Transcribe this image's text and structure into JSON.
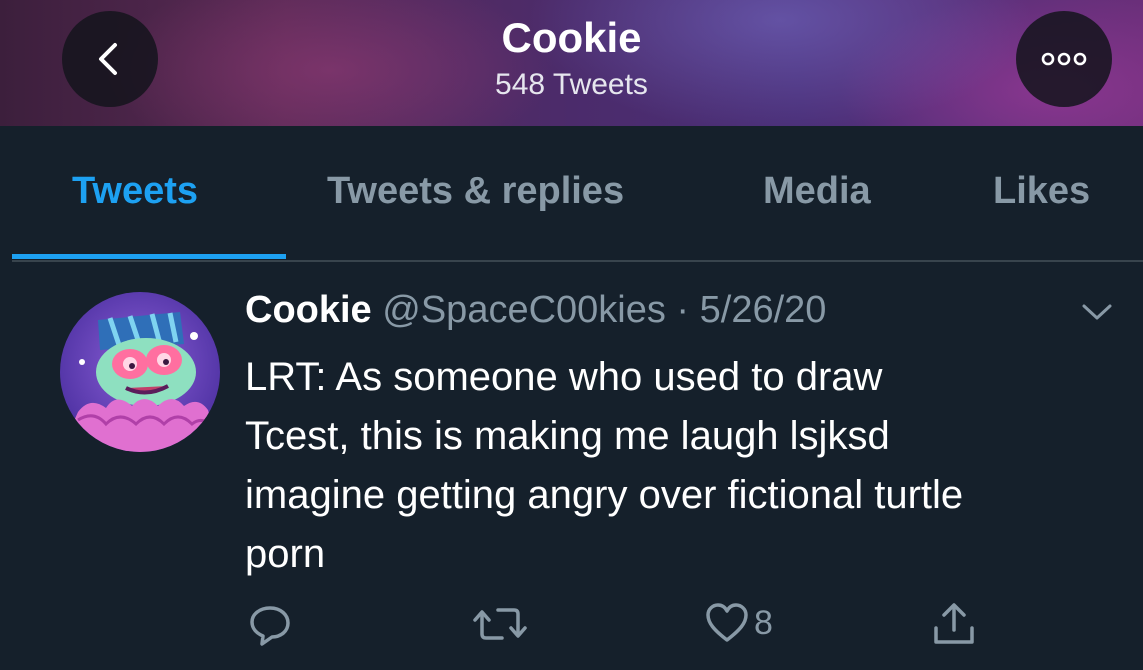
{
  "header": {
    "title": "Cookie",
    "subtitle": "548 Tweets",
    "back_icon": "chevron-left-icon",
    "more_icon": "more-dots-icon"
  },
  "tabs": [
    {
      "label": "Tweets",
      "active": true
    },
    {
      "label": "Tweets & replies",
      "active": false
    },
    {
      "label": "Media",
      "active": false
    },
    {
      "label": "Likes",
      "active": false
    }
  ],
  "tweet": {
    "display_name": "Cookie",
    "handle": "@SpaceC00kies",
    "date": "5/26/20",
    "text_lines": [
      "LRT: As someone who used to draw",
      "Tcest, this is making me laugh lsjksd",
      "imagine getting angry over fictional turtle",
      "porn"
    ],
    "actions": {
      "reply_icon": "reply-icon",
      "retweet_icon": "retweet-icon",
      "like_icon": "heart-icon",
      "like_count": "8",
      "share_icon": "share-icon"
    }
  },
  "colors": {
    "background": "#15202b",
    "accent": "#1da1f2",
    "secondary_text": "#8899a6"
  }
}
